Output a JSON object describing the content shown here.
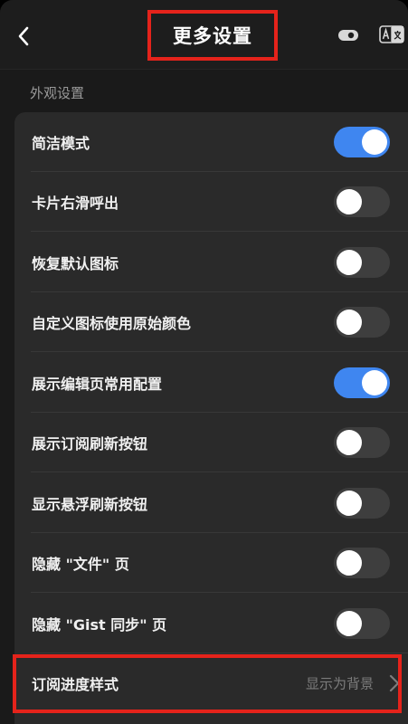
{
  "header": {
    "back_icon": "chevron-left-icon",
    "title": "更多设置",
    "eye_icon": "eye-toggle-icon",
    "translate_icon": "translate-icon"
  },
  "section": {
    "title": "外观设置"
  },
  "settings": [
    {
      "label": "简洁模式",
      "on": true
    },
    {
      "label": "卡片右滑呼出",
      "on": false
    },
    {
      "label": "恢复默认图标",
      "on": false
    },
    {
      "label": "自定义图标使用原始颜色",
      "on": false
    },
    {
      "label": "展示编辑页常用配置",
      "on": true
    },
    {
      "label": "展示订阅刷新按钮",
      "on": false
    },
    {
      "label": "显示悬浮刷新按钮",
      "on": false
    },
    {
      "label": "隐藏 \"文件\" 页",
      "on": false
    },
    {
      "label": "隐藏 \"Gist 同步\" 页",
      "on": false
    }
  ],
  "progress_style": {
    "label": "订阅进度样式",
    "value": "显示为背景",
    "chevron_icon": "chevron-right-icon"
  },
  "colors": {
    "accent": "#3f86f0",
    "highlight": "#e5231b",
    "background": "#1a1a1a",
    "card": "#2a2a2a"
  }
}
